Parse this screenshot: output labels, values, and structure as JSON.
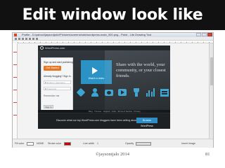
{
  "slide": {
    "title": "Edit window look like",
    "footer_credit": "©jaysonijalo 2014",
    "page_number": "81"
  },
  "window": {
    "title": "Profile - D:\\yahoo\\\\jaysonijalo\\\\Pictures\\screenshots\\wordpress-main_000.png - Paint - Lite Drawing Tool",
    "buttons": [
      "minimize",
      "maximize",
      "close"
    ]
  },
  "site": {
    "brand": "WordPress.com",
    "signup_heading": "Sign up and start publishing now.",
    "get_started": "Get Started",
    "already_blogging": "Already blogging? Sign in.",
    "username_placeholder": "Email or Username",
    "password_placeholder": "Password",
    "remember_me": "Remember me",
    "sign_in": "Sign In",
    "video_label": "Watch a video",
    "tagline": "Share with the world, your community, or your closest friends.",
    "icons": [
      "tag-icon",
      "person-icon",
      "camera-icon",
      "video-icon",
      "trophy-icon",
      "chart-icon",
      "building-icon"
    ],
    "discover_text": "Discover what our top WordPress.com bloggers have been writing about.",
    "browse_button": "Browse WordPress",
    "footer_links": "Blog · Themes · Support · Jobs · Terms of Service · Privacy"
  },
  "statusbar": {
    "fill_label": "Fill color",
    "fill_value": "NONE",
    "stroke_label": "Stroke color",
    "line_label": "Line width",
    "line_value": "1",
    "opacity_label": "Opacity",
    "layer_label": "Insert Image",
    "colors": {
      "fill": "#ffffff",
      "stroke": "#cc0000"
    }
  }
}
